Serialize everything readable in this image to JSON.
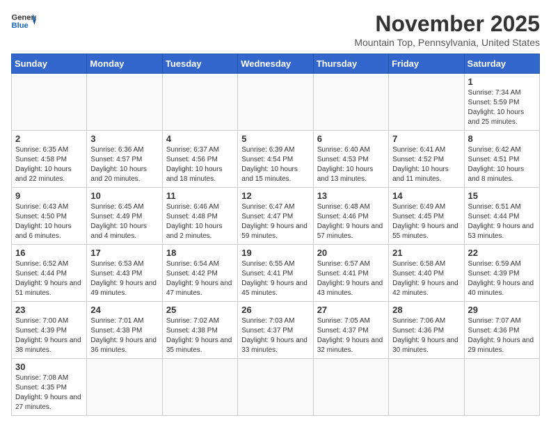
{
  "logo": {
    "text_general": "General",
    "text_blue": "Blue"
  },
  "title": "November 2025",
  "subtitle": "Mountain Top, Pennsylvania, United States",
  "days_of_week": [
    "Sunday",
    "Monday",
    "Tuesday",
    "Wednesday",
    "Thursday",
    "Friday",
    "Saturday"
  ],
  "weeks": [
    [
      {
        "day": "",
        "info": ""
      },
      {
        "day": "",
        "info": ""
      },
      {
        "day": "",
        "info": ""
      },
      {
        "day": "",
        "info": ""
      },
      {
        "day": "",
        "info": ""
      },
      {
        "day": "",
        "info": ""
      },
      {
        "day": "1",
        "info": "Sunrise: 7:34 AM\nSunset: 5:59 PM\nDaylight: 10 hours and 25 minutes."
      }
    ],
    [
      {
        "day": "2",
        "info": "Sunrise: 6:35 AM\nSunset: 4:58 PM\nDaylight: 10 hours and 22 minutes."
      },
      {
        "day": "3",
        "info": "Sunrise: 6:36 AM\nSunset: 4:57 PM\nDaylight: 10 hours and 20 minutes."
      },
      {
        "day": "4",
        "info": "Sunrise: 6:37 AM\nSunset: 4:56 PM\nDaylight: 10 hours and 18 minutes."
      },
      {
        "day": "5",
        "info": "Sunrise: 6:39 AM\nSunset: 4:54 PM\nDaylight: 10 hours and 15 minutes."
      },
      {
        "day": "6",
        "info": "Sunrise: 6:40 AM\nSunset: 4:53 PM\nDaylight: 10 hours and 13 minutes."
      },
      {
        "day": "7",
        "info": "Sunrise: 6:41 AM\nSunset: 4:52 PM\nDaylight: 10 hours and 11 minutes."
      },
      {
        "day": "8",
        "info": "Sunrise: 6:42 AM\nSunset: 4:51 PM\nDaylight: 10 hours and 8 minutes."
      }
    ],
    [
      {
        "day": "9",
        "info": "Sunrise: 6:43 AM\nSunset: 4:50 PM\nDaylight: 10 hours and 6 minutes."
      },
      {
        "day": "10",
        "info": "Sunrise: 6:45 AM\nSunset: 4:49 PM\nDaylight: 10 hours and 4 minutes."
      },
      {
        "day": "11",
        "info": "Sunrise: 6:46 AM\nSunset: 4:48 PM\nDaylight: 10 hours and 2 minutes."
      },
      {
        "day": "12",
        "info": "Sunrise: 6:47 AM\nSunset: 4:47 PM\nDaylight: 9 hours and 59 minutes."
      },
      {
        "day": "13",
        "info": "Sunrise: 6:48 AM\nSunset: 4:46 PM\nDaylight: 9 hours and 57 minutes."
      },
      {
        "day": "14",
        "info": "Sunrise: 6:49 AM\nSunset: 4:45 PM\nDaylight: 9 hours and 55 minutes."
      },
      {
        "day": "15",
        "info": "Sunrise: 6:51 AM\nSunset: 4:44 PM\nDaylight: 9 hours and 53 minutes."
      }
    ],
    [
      {
        "day": "16",
        "info": "Sunrise: 6:52 AM\nSunset: 4:44 PM\nDaylight: 9 hours and 51 minutes."
      },
      {
        "day": "17",
        "info": "Sunrise: 6:53 AM\nSunset: 4:43 PM\nDaylight: 9 hours and 49 minutes."
      },
      {
        "day": "18",
        "info": "Sunrise: 6:54 AM\nSunset: 4:42 PM\nDaylight: 9 hours and 47 minutes."
      },
      {
        "day": "19",
        "info": "Sunrise: 6:55 AM\nSunset: 4:41 PM\nDaylight: 9 hours and 45 minutes."
      },
      {
        "day": "20",
        "info": "Sunrise: 6:57 AM\nSunset: 4:41 PM\nDaylight: 9 hours and 43 minutes."
      },
      {
        "day": "21",
        "info": "Sunrise: 6:58 AM\nSunset: 4:40 PM\nDaylight: 9 hours and 42 minutes."
      },
      {
        "day": "22",
        "info": "Sunrise: 6:59 AM\nSunset: 4:39 PM\nDaylight: 9 hours and 40 minutes."
      }
    ],
    [
      {
        "day": "23",
        "info": "Sunrise: 7:00 AM\nSunset: 4:39 PM\nDaylight: 9 hours and 38 minutes."
      },
      {
        "day": "24",
        "info": "Sunrise: 7:01 AM\nSunset: 4:38 PM\nDaylight: 9 hours and 36 minutes."
      },
      {
        "day": "25",
        "info": "Sunrise: 7:02 AM\nSunset: 4:38 PM\nDaylight: 9 hours and 35 minutes."
      },
      {
        "day": "26",
        "info": "Sunrise: 7:03 AM\nSunset: 4:37 PM\nDaylight: 9 hours and 33 minutes."
      },
      {
        "day": "27",
        "info": "Sunrise: 7:05 AM\nSunset: 4:37 PM\nDaylight: 9 hours and 32 minutes."
      },
      {
        "day": "28",
        "info": "Sunrise: 7:06 AM\nSunset: 4:36 PM\nDaylight: 9 hours and 30 minutes."
      },
      {
        "day": "29",
        "info": "Sunrise: 7:07 AM\nSunset: 4:36 PM\nDaylight: 9 hours and 29 minutes."
      }
    ],
    [
      {
        "day": "30",
        "info": "Sunrise: 7:08 AM\nSunset: 4:35 PM\nDaylight: 9 hours and 27 minutes."
      },
      {
        "day": "",
        "info": ""
      },
      {
        "day": "",
        "info": ""
      },
      {
        "day": "",
        "info": ""
      },
      {
        "day": "",
        "info": ""
      },
      {
        "day": "",
        "info": ""
      },
      {
        "day": "",
        "info": ""
      }
    ]
  ]
}
